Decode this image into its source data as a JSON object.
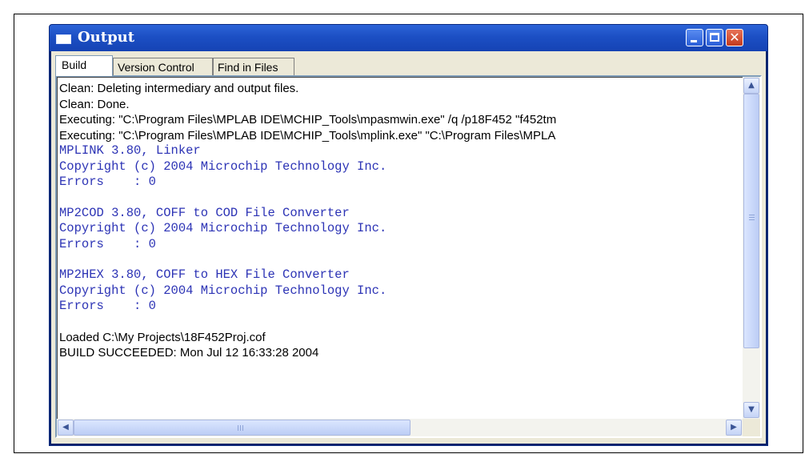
{
  "window": {
    "title": "Output",
    "close_glyph": "✕"
  },
  "tabs": [
    {
      "label": "Build",
      "active": true
    },
    {
      "label": "Version Control",
      "active": false
    },
    {
      "label": "Find in Files",
      "active": false
    }
  ],
  "output_lines": [
    "Clean: Deleting intermediary and output files.",
    "Clean: Done.",
    "Executing: \"C:\\Program Files\\MPLAB IDE\\MCHIP_Tools\\mpasmwin.exe\" /q /p18F452 \"f452tm",
    "Executing: \"C:\\Program Files\\MPLAB IDE\\MCHIP_Tools\\mplink.exe\" \"C:\\Program Files\\MPLA",
    "MPLINK 3.80, Linker",
    "Copyright (c) 2004 Microchip Technology Inc.",
    "Errors    : 0",
    "",
    "MP2COD 3.80, COFF to COD File Converter",
    "Copyright (c) 2004 Microchip Technology Inc.",
    "Errors    : 0",
    "",
    "MP2HEX 3.80, COFF to HEX File Converter",
    "Copyright (c) 2004 Microchip Technology Inc.",
    "Errors    : 0",
    "",
    "Loaded C:\\My Projects\\18F452Proj.cof",
    "BUILD SUCCEEDED: Mon Jul 12 16:33:28 2004"
  ],
  "scrollbar_glyphs": {
    "up": "▲",
    "down": "▼",
    "left": "◀",
    "right": "▶"
  },
  "colors": {
    "title_bar": "#1c4fc4",
    "tool_output_text": "#2c33b5",
    "window_body": "#ece9d8"
  }
}
